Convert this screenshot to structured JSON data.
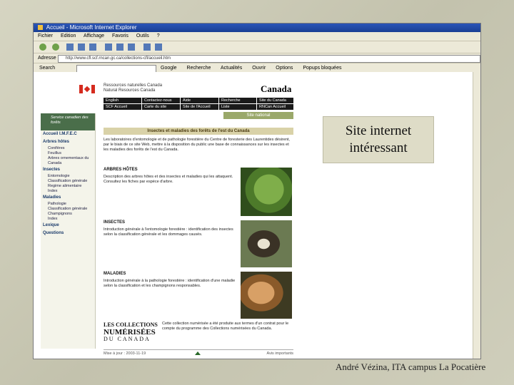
{
  "window": {
    "title": "Accueil - Microsoft Internet Explorer",
    "menu": [
      "Fichier",
      "Edition",
      "Affichage",
      "Favoris",
      "Outils",
      "?"
    ],
    "address_label": "Adresse",
    "address_value": "http://www.cfl.scf.rncan.gc.ca/collections-cfl/accueil.htm",
    "google_label": "Search",
    "google_items": [
      "Google",
      "Recherche",
      "Actualités",
      "Ouvrir",
      "Options",
      "Popups bloquées"
    ]
  },
  "site": {
    "dept_fr": "Ressources naturelles Canada",
    "dept_en": "Natural Resources Canada",
    "wordmark": "Canada",
    "fip": [
      "English",
      "Contactez-nous",
      "Aide",
      "Recherche",
      "Site du Canada",
      "SCF Accueil",
      "Carte du site",
      "Site de l'Accueil",
      "Liste",
      "RNCan Accueil"
    ],
    "site_national": "Site national",
    "left": {
      "logo": "Service canadien des forêts",
      "home": "Accueil I.M.F.E.C",
      "arbres": "Arbres hôtes",
      "arbres_items": [
        "Conifères",
        "Feuillus",
        "Arbres ornementaux du Canada"
      ],
      "insectes": "Insectes",
      "insectes_items": [
        "Entomologie",
        "Classification générale",
        "Regime alimentaire",
        "Index"
      ],
      "maladies": "Maladies",
      "maladies_items": [
        "Pathologie",
        "Classification générale",
        "Champignons",
        "Index"
      ],
      "lexique": "Lexique",
      "questions": "Questions"
    },
    "banner": "Insectes et maladies des forêts de l'est du Canada",
    "intro": "Les laboratoires d'entomologie et de pathologie forestière du Centre de foresterie des Laurentides désirent, par le biais de ce site Web, mettre à la disposition du public une base de connaissances sur les insectes et les maladies des forêts de l'est du Canada.",
    "arbres_h": "ARBRES HÔTES",
    "arbres_txt": "Description des arbres hôtes et des insectes et maladies qui les attaquent. Consultez les fiches par espèce d'arbre.",
    "insectes_h": "INSECTES",
    "insectes_txt": "Introduction générale à l'entomologie forestière : identification des insectes selon la classification générale et les dommages causés.",
    "maladies_h": "MALADIES",
    "maladies_txt": "Introduction générale à la pathologie forestière : identification d'une maladie selon la classification et les champignons responsables.",
    "collections": "LES COLLECTIONS",
    "numerisees": "NUMÉRISÉES",
    "du_canada": "DU CANADA",
    "collections_txt": "Cette collection numérisée a été produite aux termes d'un contrat pour le compte du programme des Collections numérisées du Canada.",
    "footer_left": "Mise à jour : 2003-11-19",
    "footer_right": "Avis importants"
  },
  "overlay": {
    "line1": "Site internet",
    "line2": "intéressant"
  },
  "credit": "André Vézina, ITA campus La Pocatière"
}
